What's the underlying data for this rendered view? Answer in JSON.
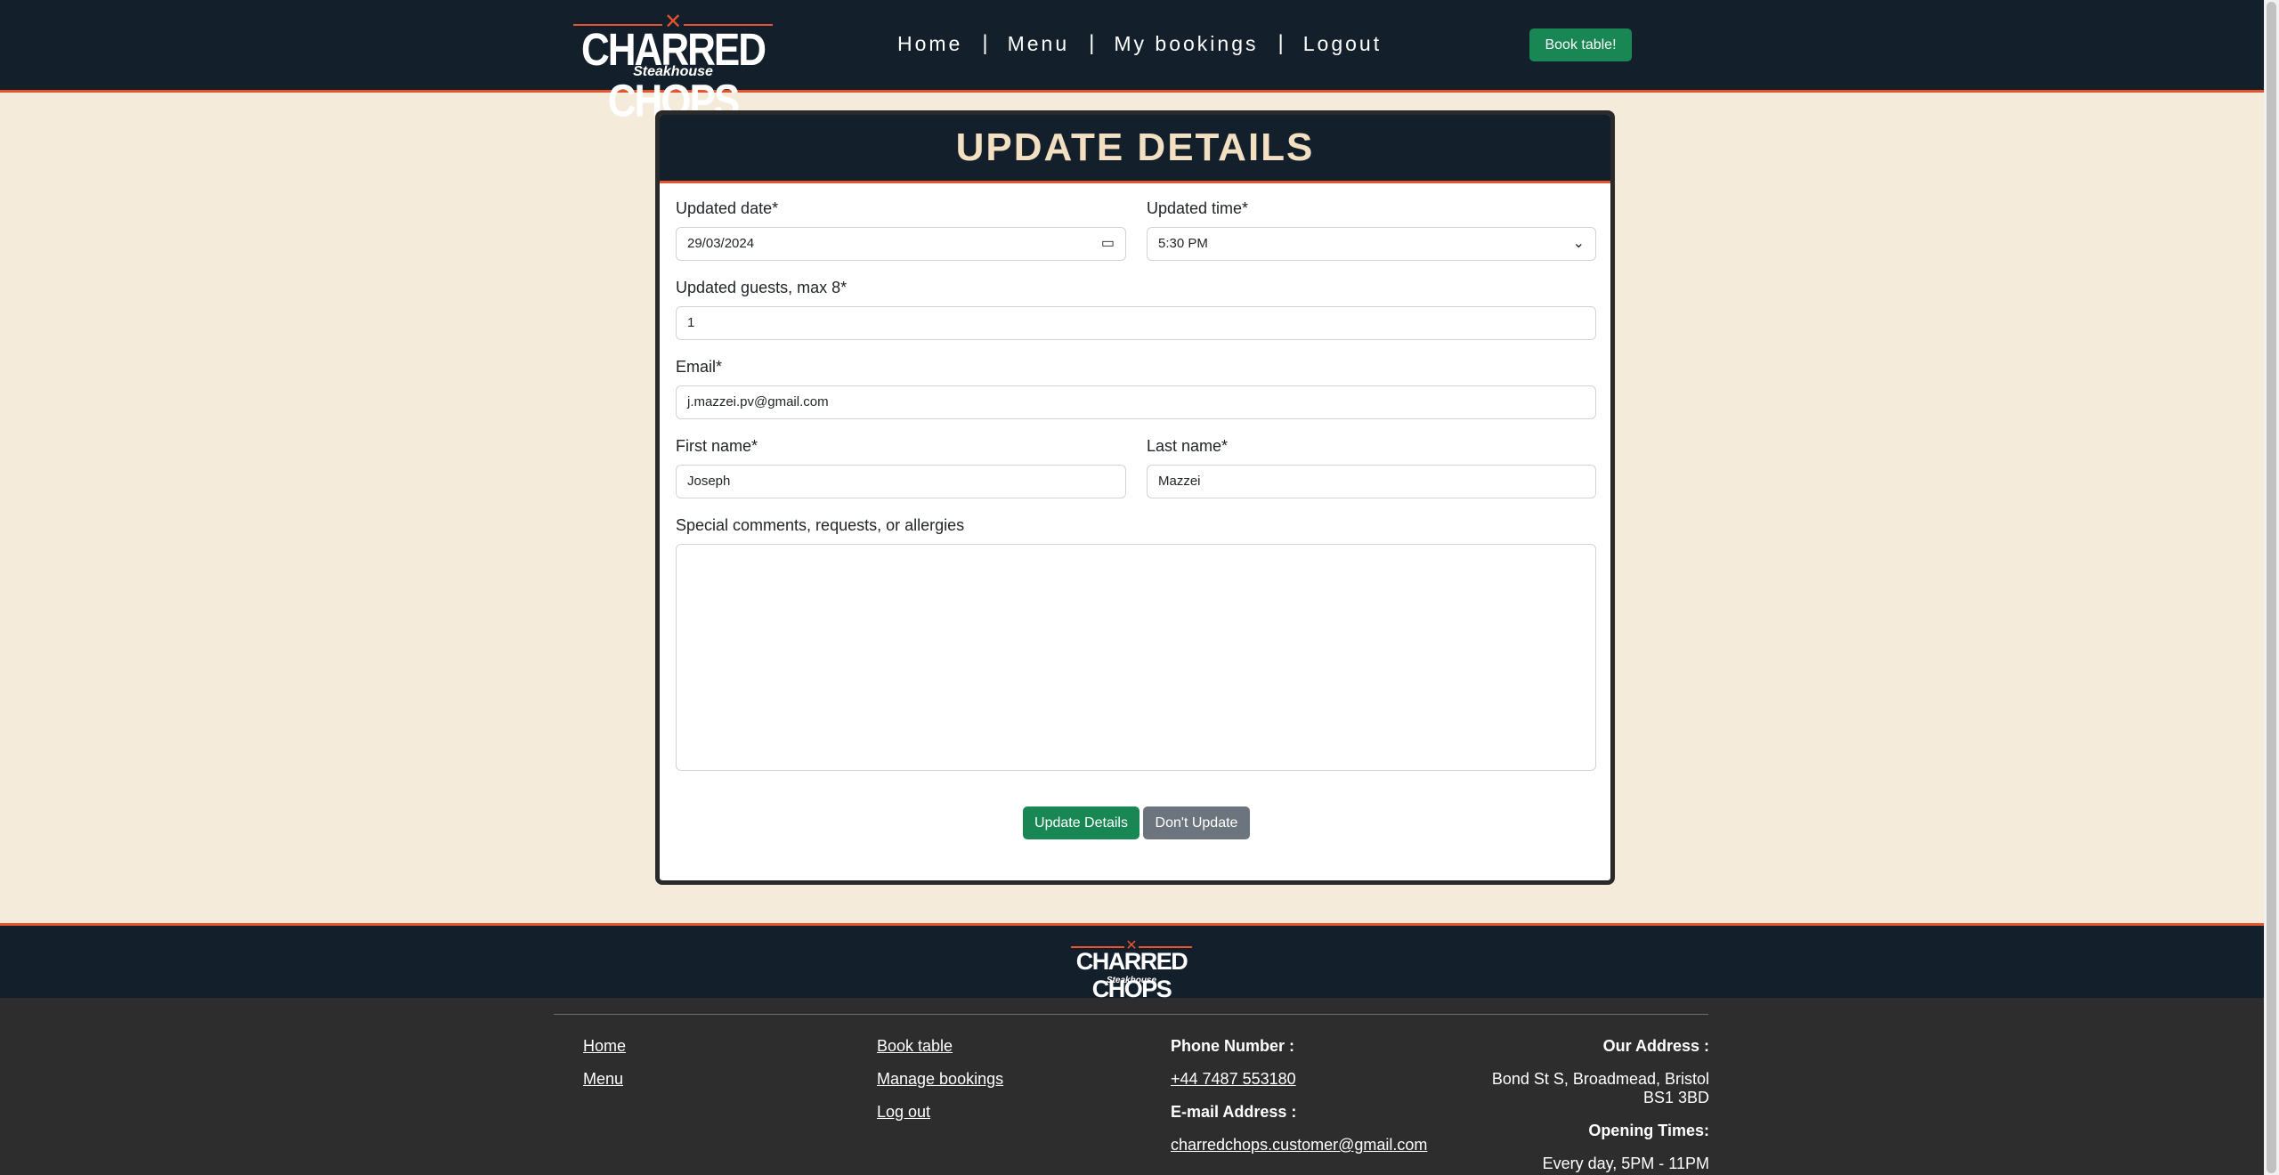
{
  "header": {
    "logo_brand": "CHARRED CHOPS",
    "logo_tagline": "Steakhouse",
    "nav": [
      "Home",
      "Menu",
      "My bookings",
      "Logout"
    ],
    "nav_separator": "|",
    "book_button": "Book table!"
  },
  "form": {
    "title": "UPDATE DETAILS",
    "date_label": "Updated date*",
    "date_value": "29/03/2024",
    "time_label": "Updated time*",
    "time_value": "5:30 PM",
    "guests_label": "Updated guests, max 8*",
    "guests_value": "1",
    "email_label": "Email*",
    "email_value": "j.mazzei.pv@gmail.com",
    "first_name_label": "First name*",
    "first_name_value": "Joseph",
    "last_name_label": "Last name*",
    "last_name_value": "Mazzei",
    "comments_label": "Special comments, requests, or allergies",
    "comments_value": "",
    "update_button": "Update Details",
    "cancel_button": "Don't Update"
  },
  "footer": {
    "logo_brand": "CHARRED CHOPS",
    "logo_tagline": "Steakhouse",
    "links_col1": [
      "Home",
      "Menu"
    ],
    "links_col2": [
      "Book table",
      "Manage bookings",
      "Log out"
    ],
    "phone_heading": "Phone Number :",
    "phone": "+44 7487 553180",
    "email_heading": "E-mail Address :",
    "email": "charredchops.customer@gmail.com",
    "address_heading": "Our Address :",
    "address": "Bond St S, Broadmead, Bristol BS1 3BD",
    "hours_heading": "Opening Times:",
    "hours": "Every day, 5PM - 11PM"
  },
  "colors": {
    "navy": "#13202b",
    "accent": "#e6532c",
    "green": "#198754",
    "gray": "#6c757d",
    "background": "#f5ebdb"
  }
}
